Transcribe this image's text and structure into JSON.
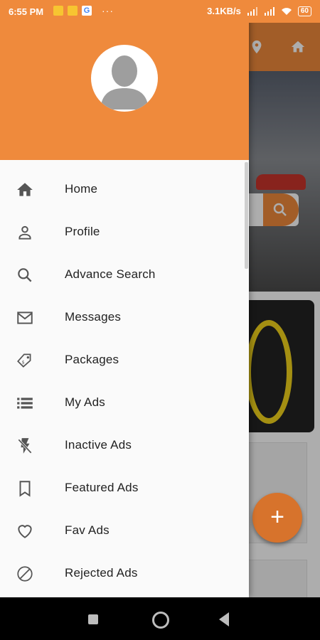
{
  "status_bar": {
    "time": "6:55 PM",
    "g_label": "G",
    "dots": "···",
    "speed": "3.1KB/s",
    "battery": "60"
  },
  "drawer": {
    "menu": [
      {
        "label": "Home",
        "icon": "home-icon"
      },
      {
        "label": "Profile",
        "icon": "person-icon"
      },
      {
        "label": "Advance Search",
        "icon": "search-icon"
      },
      {
        "label": "Messages",
        "icon": "mail-icon"
      },
      {
        "label": "Packages",
        "icon": "tag-icon"
      },
      {
        "label": "My Ads",
        "icon": "list-icon"
      },
      {
        "label": "Inactive Ads",
        "icon": "flash-off-icon"
      },
      {
        "label": "Featured Ads",
        "icon": "bookmark-icon"
      },
      {
        "label": "Fav Ads",
        "icon": "heart-icon"
      },
      {
        "label": "Rejected Ads",
        "icon": "block-icon"
      }
    ]
  },
  "fab": {
    "label": "+"
  },
  "colors": {
    "accent": "#ef8a3c",
    "fab": "#d7732c",
    "icon": "#555555"
  }
}
